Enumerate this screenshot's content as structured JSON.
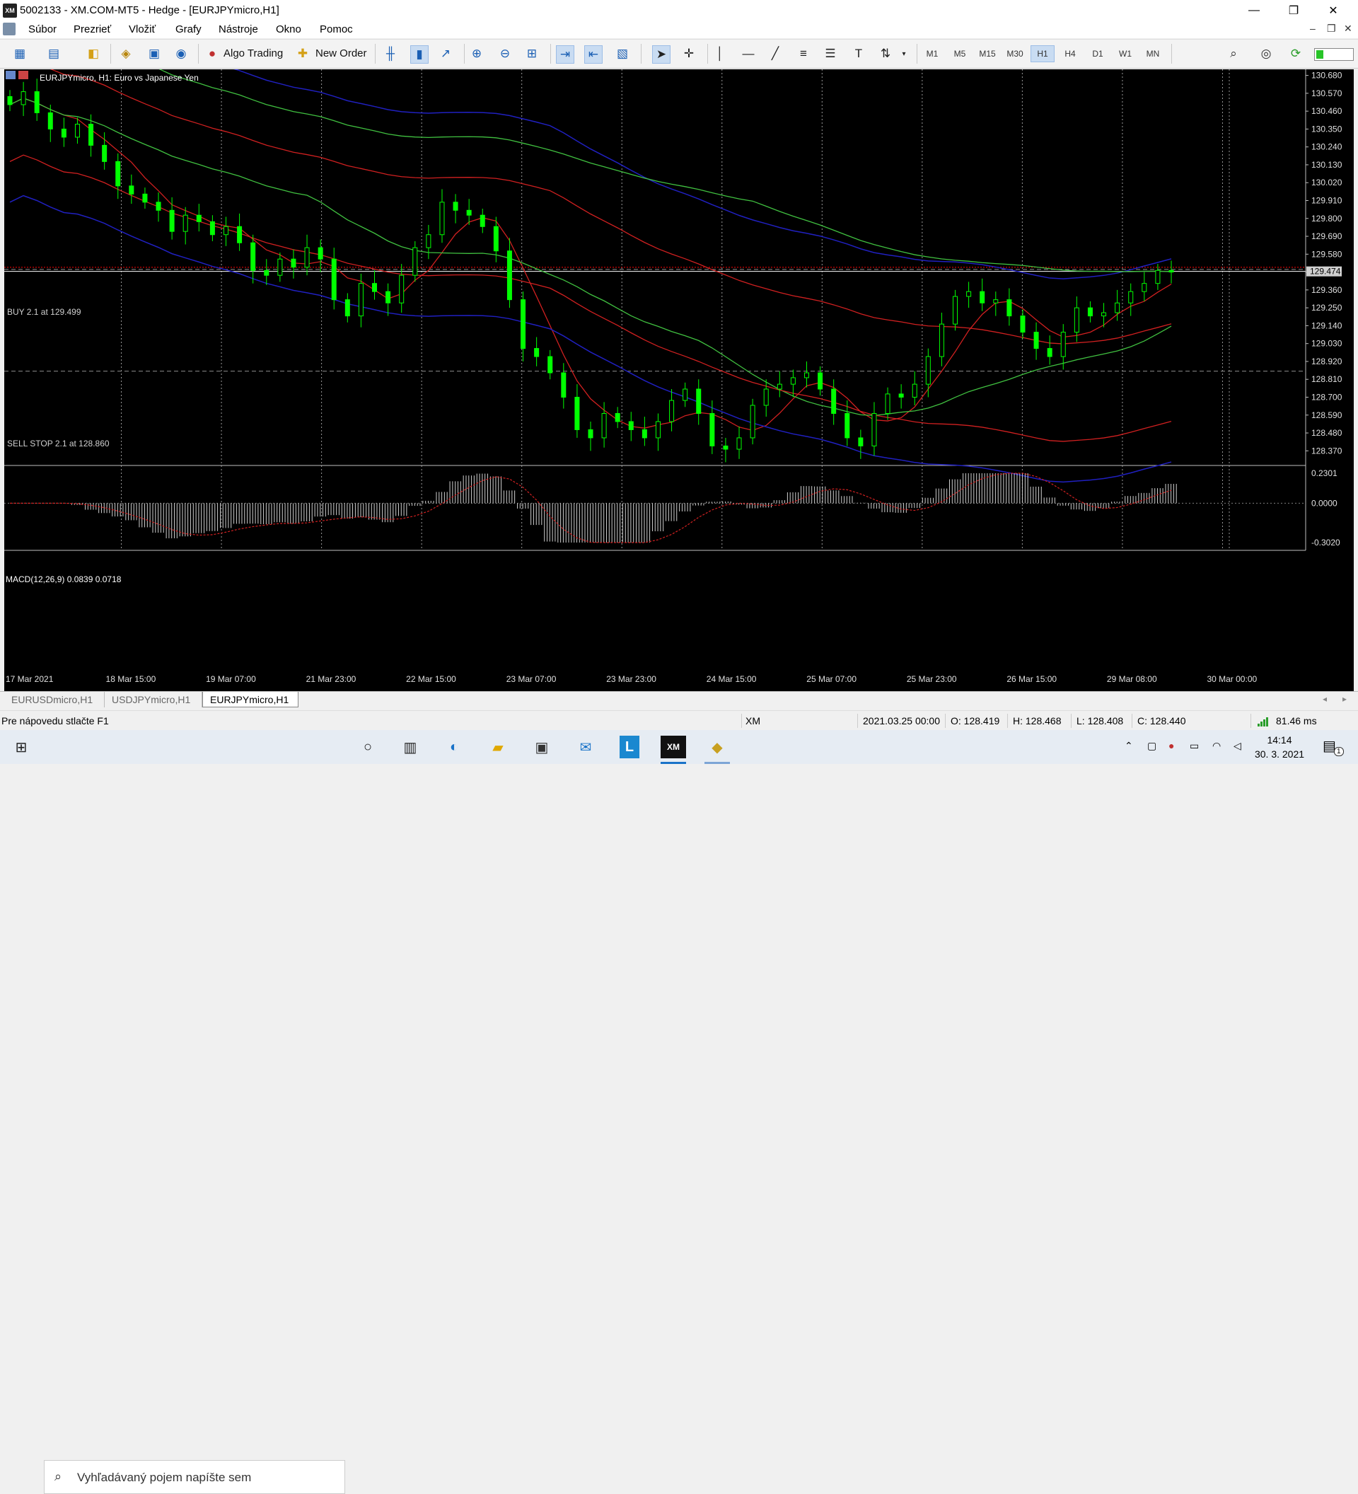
{
  "window": {
    "title": "5002133 - XM.COM-MT5 - Hedge - [EURJPYmicro,H1]",
    "logo_text": "XM",
    "controls": {
      "minimize": "—",
      "restore": "❐",
      "close": "✕"
    }
  },
  "menu": {
    "items": [
      "Súbor",
      "Prezrieť",
      "Vložiť",
      "Grafy",
      "Nástroje",
      "Okno",
      "Pomoc"
    ],
    "mdi": {
      "minimize": "–",
      "restore": "❐",
      "close": "✕"
    }
  },
  "toolbar": {
    "algo_trading": "Algo Trading",
    "new_order": "New Order",
    "timeframes": [
      "M1",
      "M5",
      "M15",
      "M30",
      "H1",
      "H4",
      "D1",
      "W1",
      "MN"
    ],
    "active_timeframe": "H1"
  },
  "chart": {
    "header": "EURJPYmicro, H1:  Euro vs Japanese Yen",
    "buy_label": "BUY 2.1 at 129.499",
    "sellstop_label": "SELL STOP 2.1 at 128.860",
    "current_price": "129.474",
    "price_ticks": [
      "130.680",
      "130.570",
      "130.460",
      "130.350",
      "130.240",
      "130.130",
      "130.020",
      "129.910",
      "129.800",
      "129.690",
      "129.580",
      "129.470",
      "129.360",
      "129.250",
      "129.140",
      "129.030",
      "128.920",
      "128.810",
      "128.700",
      "128.590",
      "128.480",
      "128.370"
    ],
    "macd_label": "MACD(12,26,9) 0.0839 0.0718",
    "macd_ticks": [
      "0.2301",
      "0.0000",
      "-0.3020"
    ],
    "time_labels": [
      "17 Mar 2021",
      "18 Mar 15:00",
      "19 Mar 07:00",
      "21 Mar 23:00",
      "22 Mar 15:00",
      "23 Mar 07:00",
      "23 Mar 23:00",
      "24 Mar 15:00",
      "25 Mar 07:00",
      "25 Mar 23:00",
      "26 Mar 15:00",
      "29 Mar 08:00",
      "30 Mar 00:00"
    ],
    "colors": {
      "bull": "#00ff00",
      "background": "#000000",
      "grid": "#c0c0c0",
      "ma_red": "#d02020",
      "ma_green": "#40c040",
      "ma_blue": "#2020c0",
      "price_marker": "#ff0000"
    }
  },
  "chart_data": {
    "type": "candlestick",
    "symbol": "EURJPYmicro",
    "timeframe": "H1",
    "ylim": [
      128.28,
      130.7
    ],
    "close_series": [
      130.5,
      130.58,
      130.45,
      130.35,
      130.3,
      130.38,
      130.25,
      130.15,
      130.0,
      129.95,
      129.9,
      129.85,
      129.72,
      129.82,
      129.78,
      129.7,
      129.75,
      129.65,
      129.48,
      129.45,
      129.55,
      129.5,
      129.62,
      129.55,
      129.3,
      129.2,
      129.4,
      129.35,
      129.28,
      129.45,
      129.62,
      129.7,
      129.9,
      129.85,
      129.82,
      129.75,
      129.6,
      129.3,
      129.0,
      128.95,
      128.85,
      128.7,
      128.5,
      128.45,
      128.6,
      128.55,
      128.5,
      128.45,
      128.55,
      128.68,
      128.75,
      128.6,
      128.4,
      128.38,
      128.45,
      128.65,
      128.75,
      128.78,
      128.82,
      128.85,
      128.75,
      128.6,
      128.45,
      128.4,
      128.6,
      128.72,
      128.7,
      128.78,
      128.95,
      129.15,
      129.32,
      129.35,
      129.28,
      129.3,
      129.2,
      129.1,
      129.0,
      128.95,
      129.1,
      129.25,
      129.2,
      129.22,
      129.28,
      129.35,
      129.4,
      129.48,
      129.47
    ],
    "macd_label": "MACD(12,26,9) 0.0839 0.0718",
    "macd_ylim": [
      -0.302,
      0.2301
    ]
  },
  "tabs": [
    "EURUSDmicro,H1",
    "USDJPYmicro,H1",
    "EURJPYmicro,H1"
  ],
  "active_tab": "EURJPYmicro,H1",
  "status": {
    "help": "Pre nápovedu stlačte F1",
    "profile": "XM",
    "datetime": "2021.03.25 00:00",
    "open": "O: 128.419",
    "high": "H: 128.468",
    "low": "L: 128.408",
    "close": "C: 128.440",
    "ping": "81.46 ms"
  },
  "taskbar": {
    "search_placeholder": "Vyhľadávaný pojem napíšte sem",
    "time": "14:14",
    "date": "30. 3. 2021",
    "notifications": "1",
    "xm_label": "XM"
  }
}
